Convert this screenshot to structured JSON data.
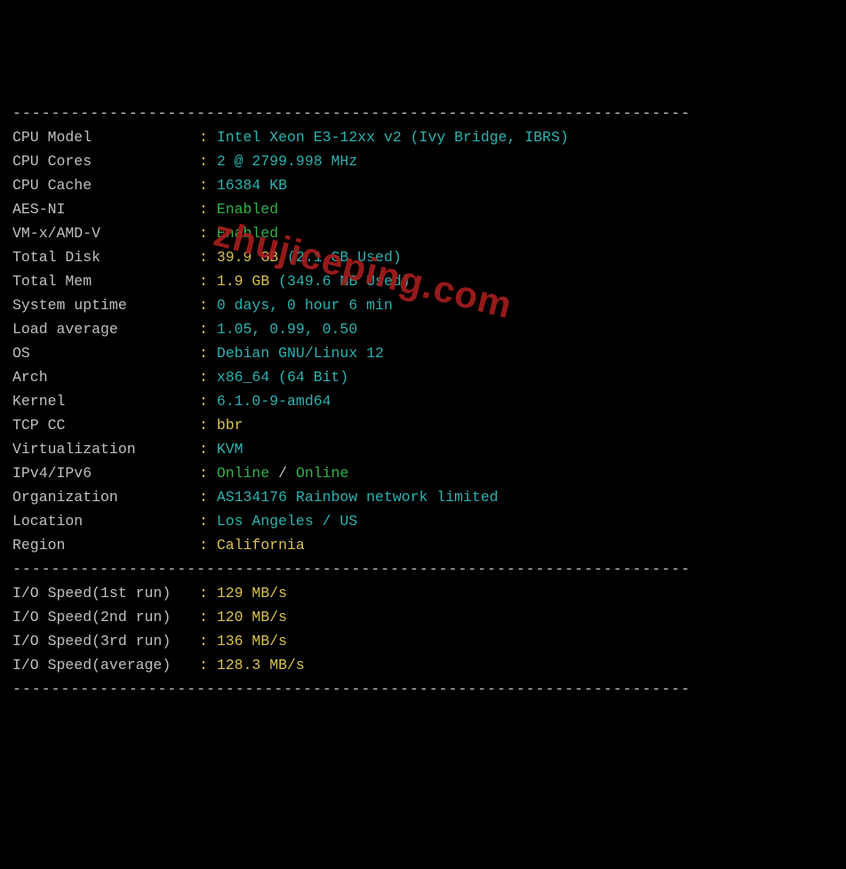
{
  "dashline": "----------------------------------------------------------------------",
  "sys": [
    {
      "label": "CPU Model",
      "parts": [
        {
          "cls": "cyan",
          "text": "Intel Xeon E3-12xx v2 (Ivy Bridge, IBRS)"
        }
      ]
    },
    {
      "label": "CPU Cores",
      "parts": [
        {
          "cls": "cyan",
          "text": "2 @ 2799.998 MHz"
        }
      ]
    },
    {
      "label": "CPU Cache",
      "parts": [
        {
          "cls": "cyan",
          "text": "16384 KB"
        }
      ]
    },
    {
      "label": "AES-NI",
      "parts": [
        {
          "cls": "green",
          "text": "Enabled"
        }
      ]
    },
    {
      "label": "VM-x/AMD-V",
      "parts": [
        {
          "cls": "green",
          "text": "Enabled"
        }
      ]
    },
    {
      "label": "Total Disk",
      "parts": [
        {
          "cls": "yellow",
          "text": "39.9 GB"
        },
        {
          "cls": "cyan",
          "text": " (2.1 GB Used)"
        }
      ]
    },
    {
      "label": "Total Mem",
      "parts": [
        {
          "cls": "yellow",
          "text": "1.9 GB"
        },
        {
          "cls": "cyan",
          "text": " (349.6 MB Used)"
        }
      ]
    },
    {
      "label": "System uptime",
      "parts": [
        {
          "cls": "cyan",
          "text": "0 days, 0 hour 6 min"
        }
      ]
    },
    {
      "label": "Load average",
      "parts": [
        {
          "cls": "cyan",
          "text": "1.05, 0.99, 0.50"
        }
      ]
    },
    {
      "label": "OS",
      "parts": [
        {
          "cls": "cyan",
          "text": "Debian GNU/Linux 12"
        }
      ]
    },
    {
      "label": "Arch",
      "parts": [
        {
          "cls": "cyan",
          "text": "x86_64 (64 Bit)"
        }
      ]
    },
    {
      "label": "Kernel",
      "parts": [
        {
          "cls": "cyan",
          "text": "6.1.0-9-amd64"
        }
      ]
    },
    {
      "label": "TCP CC",
      "parts": [
        {
          "cls": "yellow",
          "text": "bbr"
        }
      ]
    },
    {
      "label": "Virtualization",
      "parts": [
        {
          "cls": "cyan",
          "text": "KVM"
        }
      ]
    },
    {
      "label": "IPv4/IPv6",
      "parts": [
        {
          "cls": "green",
          "text": "Online"
        },
        {
          "cls": "white",
          "text": " / "
        },
        {
          "cls": "green",
          "text": "Online"
        }
      ]
    },
    {
      "label": "Organization",
      "parts": [
        {
          "cls": "cyan",
          "text": "AS134176 Rainbow network limited"
        }
      ]
    },
    {
      "label": "Location",
      "parts": [
        {
          "cls": "cyan",
          "text": "Los Angeles / US"
        }
      ]
    },
    {
      "label": "Region",
      "parts": [
        {
          "cls": "yellow",
          "text": "California"
        }
      ]
    }
  ],
  "io": [
    {
      "label": "I/O Speed(1st run)",
      "parts": [
        {
          "cls": "yellow",
          "text": "129 MB/s"
        }
      ]
    },
    {
      "label": "I/O Speed(2nd run)",
      "parts": [
        {
          "cls": "yellow",
          "text": "120 MB/s"
        }
      ]
    },
    {
      "label": "I/O Speed(3rd run)",
      "parts": [
        {
          "cls": "yellow",
          "text": "136 MB/s"
        }
      ]
    },
    {
      "label": "I/O Speed(average)",
      "parts": [
        {
          "cls": "yellow",
          "text": "128.3 MB/s"
        }
      ]
    }
  ],
  "watermark": "zhujiceping.com"
}
